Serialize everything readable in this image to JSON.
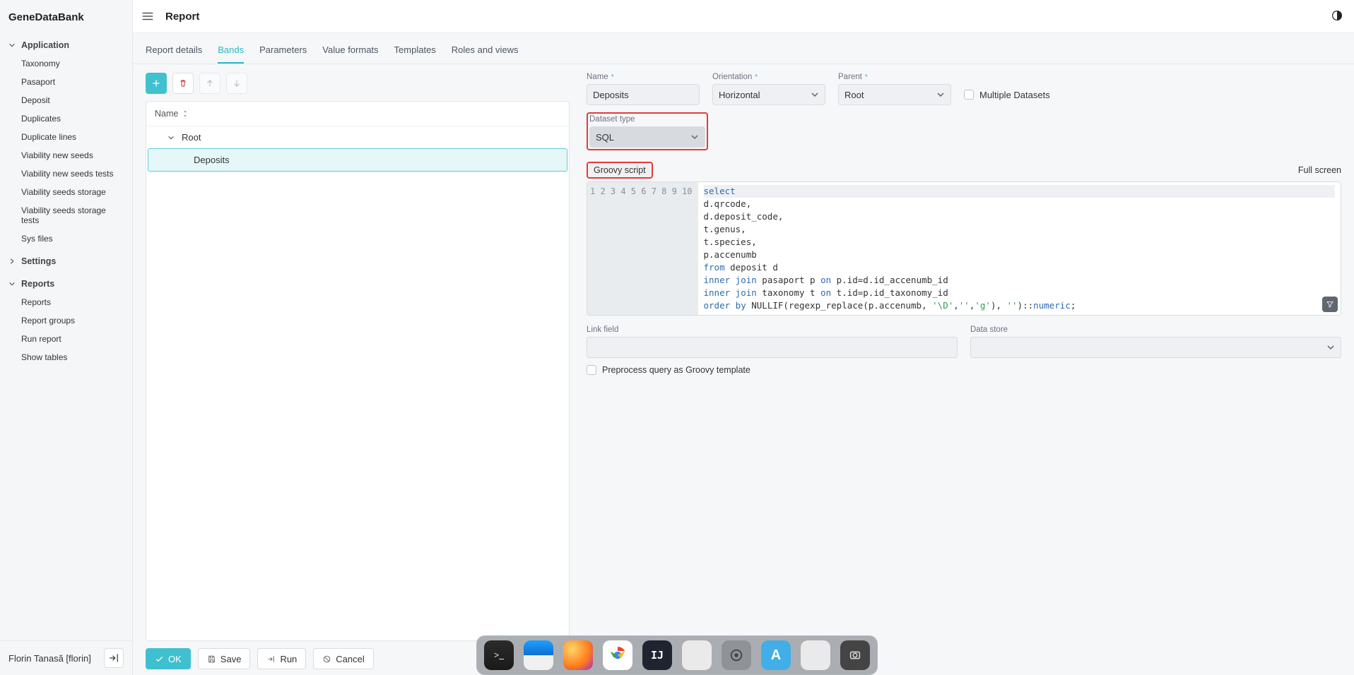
{
  "brand": "GeneDataBank",
  "page_title": "Report",
  "sidebar": {
    "sections": {
      "application": {
        "label": "Application",
        "items": [
          "Taxonomy",
          "Pasaport",
          "Deposit",
          "Duplicates",
          "Duplicate lines",
          "Viability new seeds",
          "Viability new seeds tests",
          "Viability seeds storage",
          "Viability seeds storage tests",
          "Sys files"
        ]
      },
      "settings": {
        "label": "Settings"
      },
      "reports": {
        "label": "Reports",
        "items": [
          "Reports",
          "Report groups",
          "Run report",
          "Show tables"
        ]
      }
    },
    "user_display": "Florin Tanasă [florin]"
  },
  "tabs": [
    "Report details",
    "Bands",
    "Parameters",
    "Value formats",
    "Templates",
    "Roles and views"
  ],
  "active_tab": "Bands",
  "bands_table": {
    "column": "Name",
    "rows": [
      {
        "label": "Root",
        "depth": 0
      },
      {
        "label": "Deposits",
        "depth": 1,
        "selected": true
      }
    ]
  },
  "form": {
    "name": {
      "label": "Name",
      "value": "Deposits"
    },
    "orientation": {
      "label": "Orientation",
      "value": "Horizontal"
    },
    "parent": {
      "label": "Parent",
      "value": "Root"
    },
    "multiple_datasets": {
      "label": "Multiple Datasets",
      "checked": false
    },
    "dataset_type": {
      "label": "Dataset type",
      "value": "SQL"
    },
    "script_label": "Groovy script",
    "fullscreen_label": "Full screen",
    "link_field": {
      "label": "Link field",
      "value": ""
    },
    "data_store": {
      "label": "Data store",
      "value": ""
    },
    "preprocess": {
      "label": "Preprocess query as Groovy template",
      "checked": false
    }
  },
  "code_lines": [
    {
      "n": 1,
      "html": "<span class='kw'>select</span>"
    },
    {
      "n": 2,
      "html": "d.qrcode,"
    },
    {
      "n": 3,
      "html": "d.deposit_code,"
    },
    {
      "n": 4,
      "html": "t.genus,"
    },
    {
      "n": 5,
      "html": "t.species,"
    },
    {
      "n": 6,
      "html": "p.accenumb"
    },
    {
      "n": 7,
      "html": "<span class='kw'>from</span> deposit d"
    },
    {
      "n": 8,
      "html": "<span class='kw'>inner</span> <span class='kw'>join</span> pasaport p <span class='kw'>on</span> p.id=d.id_accenumb_id"
    },
    {
      "n": 9,
      "html": "<span class='kw'>inner</span> <span class='kw'>join</span> taxonomy t <span class='kw'>on</span> t.id=p.id_taxonomy_id"
    },
    {
      "n": 10,
      "html": "<span class='kw'>order</span> <span class='kw'>by</span> NULLIF(regexp_replace(p.accenumb, <span class='str'>'\\D'</span>,<span class='str'>''</span>,<span class='str'>'g'</span>), <span class='str'>''</span>)::<span class='kw'>numeric</span>;"
    }
  ],
  "bottom_buttons": {
    "ok": "OK",
    "save": "Save",
    "run": "Run",
    "cancel": "Cancel"
  }
}
